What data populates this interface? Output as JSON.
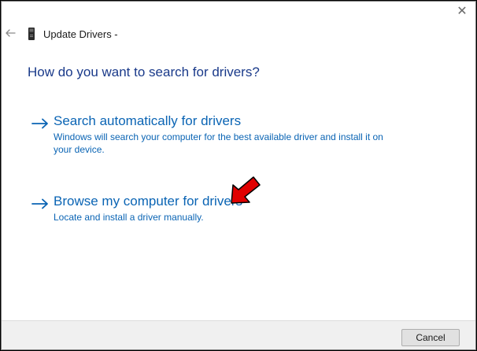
{
  "window": {
    "title": "Update Drivers -",
    "close_label": "✕",
    "icons": {
      "back": "back-arrow-icon",
      "device": "device-icon",
      "close": "close-icon",
      "option_arrow": "right-arrow-icon",
      "annotation": "red-pointer-arrow"
    }
  },
  "main": {
    "heading": "How do you want to search for drivers?",
    "options": [
      {
        "title": "Search automatically for drivers",
        "description": "Windows will search your computer for the best available driver and install it on your device."
      },
      {
        "title": "Browse my computer for drivers",
        "description": "Locate and install a driver manually."
      }
    ]
  },
  "footer": {
    "cancel_label": "Cancel"
  },
  "colors": {
    "heading": "#1a3a8a",
    "link": "#0a64b4",
    "annotation_red": "#e00000",
    "footer_bg": "#f0f0f0"
  }
}
